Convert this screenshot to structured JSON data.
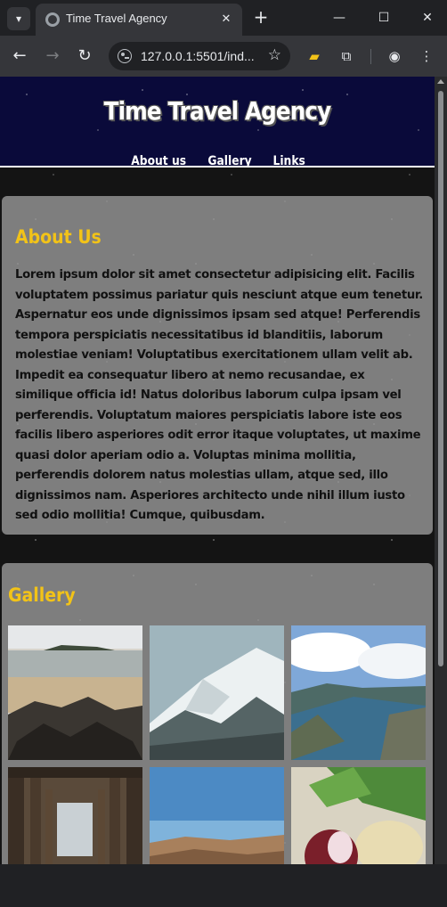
{
  "browser": {
    "tab_title": "Time Travel Agency",
    "url": "127.0.0.1:5501/ind...",
    "tab_close": "✕",
    "new_tab": "+",
    "icons": {
      "tab_list": "chevron-down-icon",
      "back": "arrow-left-icon",
      "forward": "arrow-right-icon",
      "reload": "reload-icon",
      "bookmark": "star-icon",
      "extensions": "puzzle-icon",
      "profile": "profile-icon",
      "menu": "kebab-menu-icon"
    }
  },
  "site": {
    "title": "Time Travel Agency",
    "nav": [
      "About us",
      "Gallery",
      "Links"
    ],
    "about": {
      "heading": "About Us",
      "body": "Lorem ipsum dolor sit amet consectetur adipisicing elit. Facilis voluptatem possimus pariatur quis nesciunt atque eum tenetur. Aspernatur eos unde dignissimos ipsam sed atque! Perferendis tempora perspiciatis necessitatibus id blanditiis, laborum molestiae veniam! Voluptatibus exercitationem ullam velit ab. Impedit ea consequatur libero at nemo recusandae, ex similique officia id! Natus doloribus laborum culpa ipsam vel perferendis. Voluptatum maiores perspiciatis labore iste eos facilis libero asperiores odit error itaque voluptates, ut maxime quasi dolor aperiam odio a. Voluptas minima mollitia, perferendis dolorem natus molestias ullam, atque sed, illo dignissimos nam. Asperiores architecto unde nihil illum iusto sed odio mollitia! Cumque, quibusdam."
    },
    "gallery": {
      "heading": "Gallery",
      "images": [
        "beach-rocks",
        "snowy-mountain",
        "fjord",
        "pier-underside",
        "desert-valley",
        "onion-vegetables"
      ]
    }
  },
  "colors": {
    "header_bg": "#0a0a3a",
    "heading_accent": "#f2c318",
    "panel_bg": "#969696"
  }
}
